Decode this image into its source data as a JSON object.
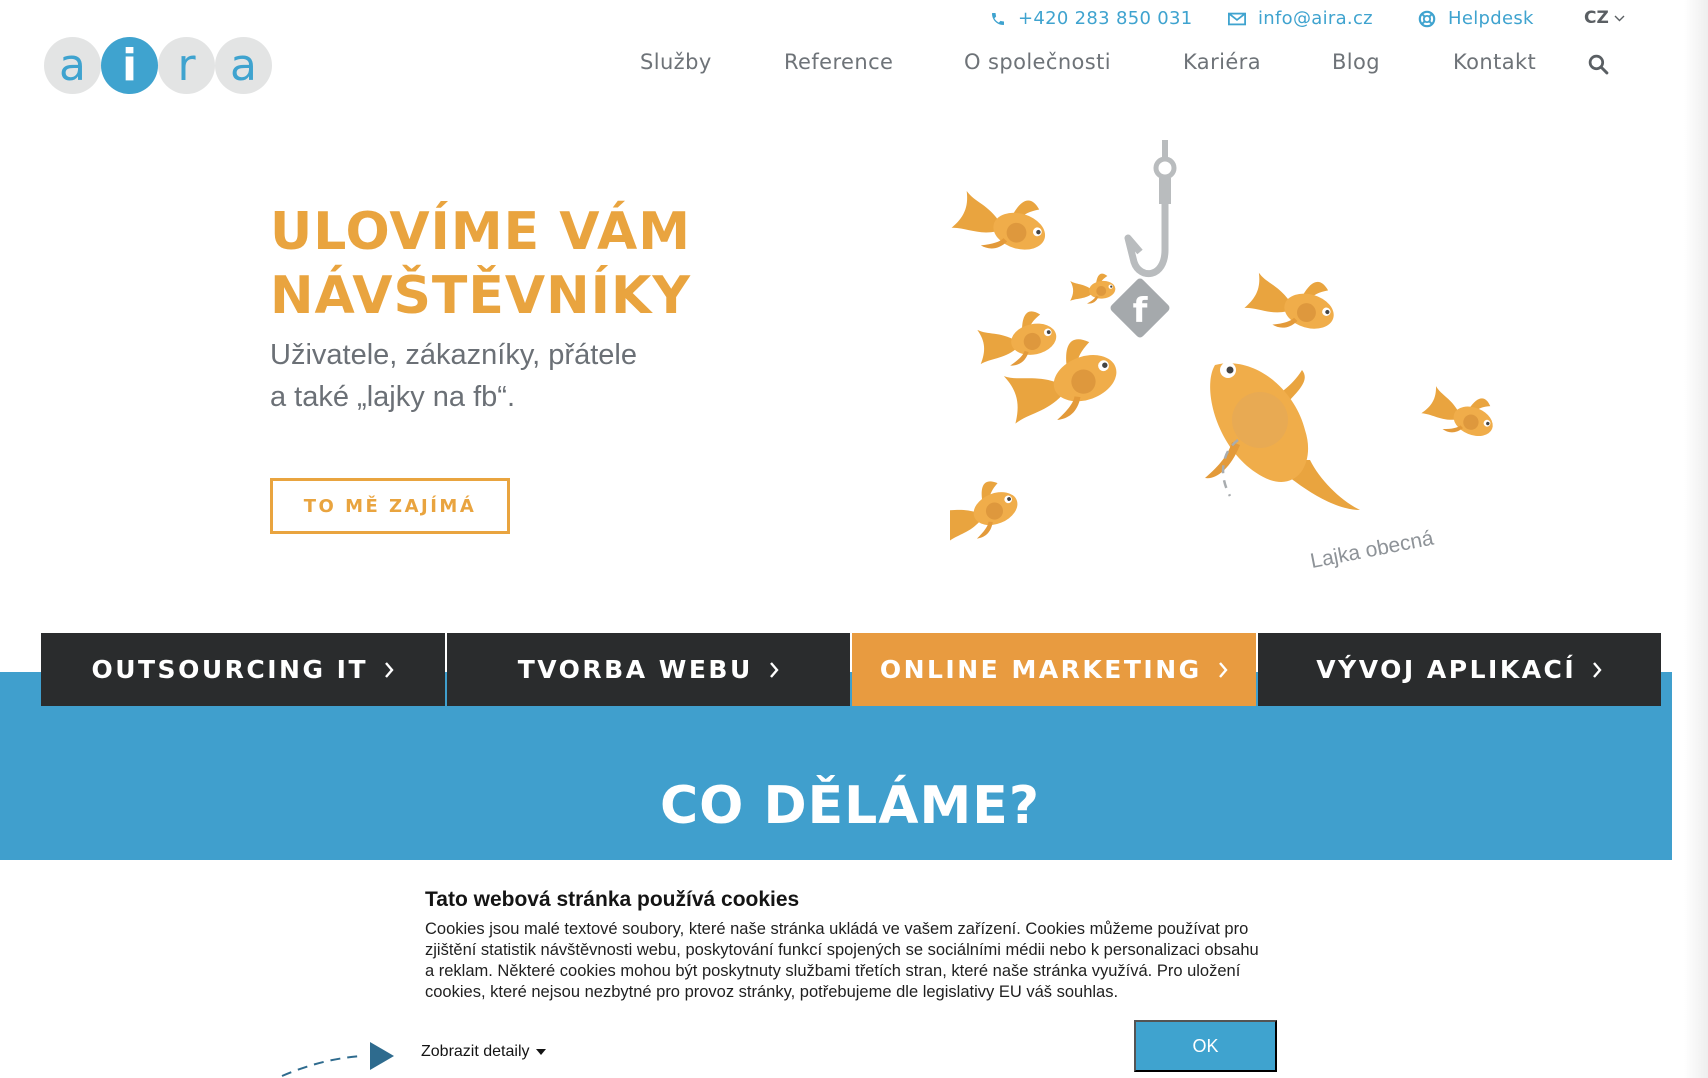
{
  "topbar": {
    "phone": "+420 283 850 031",
    "email": "info@aira.cz",
    "helpdesk": "Helpdesk",
    "language": "CZ"
  },
  "logo": {
    "letters": [
      "a",
      "i",
      "r",
      "a"
    ]
  },
  "nav": {
    "items": [
      "Služby",
      "Reference",
      "O společnosti",
      "Kariéra",
      "Blog",
      "Kontakt"
    ]
  },
  "hero": {
    "title_line1": "ULOVÍME VÁM",
    "title_line2": "NÁVŠTĚVNÍKY",
    "subtitle_line1": "Uživatele, zákazníky, přátele",
    "subtitle_line2": "a také „lajky na fb“.",
    "button": "TO MĚ ZAJÍMÁ",
    "illustration_caption": "Lajka obecná"
  },
  "services": {
    "tabs": [
      "OUTSOURCING IT",
      "TVORBA WEBU",
      "ONLINE MARKETING",
      "VÝVOJ APLIKACÍ"
    ],
    "active_index": 2,
    "section_title": "CO DĚLÁME?"
  },
  "cookie": {
    "title": "Tato webová stránka používá cookies",
    "text": "Cookies jsou malé textové soubory, které naše stránka ukládá ve vašem zařízení. Cookies můžeme používat pro zjištění statistik návštěvnosti webu, poskytování funkcí spojených se sociálními médii nebo k personalizaci obsahu a reklam. Některé cookies mohou být poskytnuty službami třetích stran, které naše stránka využívá. Pro uložení cookies, které nejsou nezbytné pro provoz stránky, potřebujeme dle legislativy EU váš souhlas.",
    "details": "Zobrazit detaily",
    "ok": "OK"
  },
  "colors": {
    "brand_blue": "#409fcd",
    "brand_orange": "#e9a43f",
    "dark_tab": "#2a2c2d",
    "text_gray": "#6e7378"
  }
}
